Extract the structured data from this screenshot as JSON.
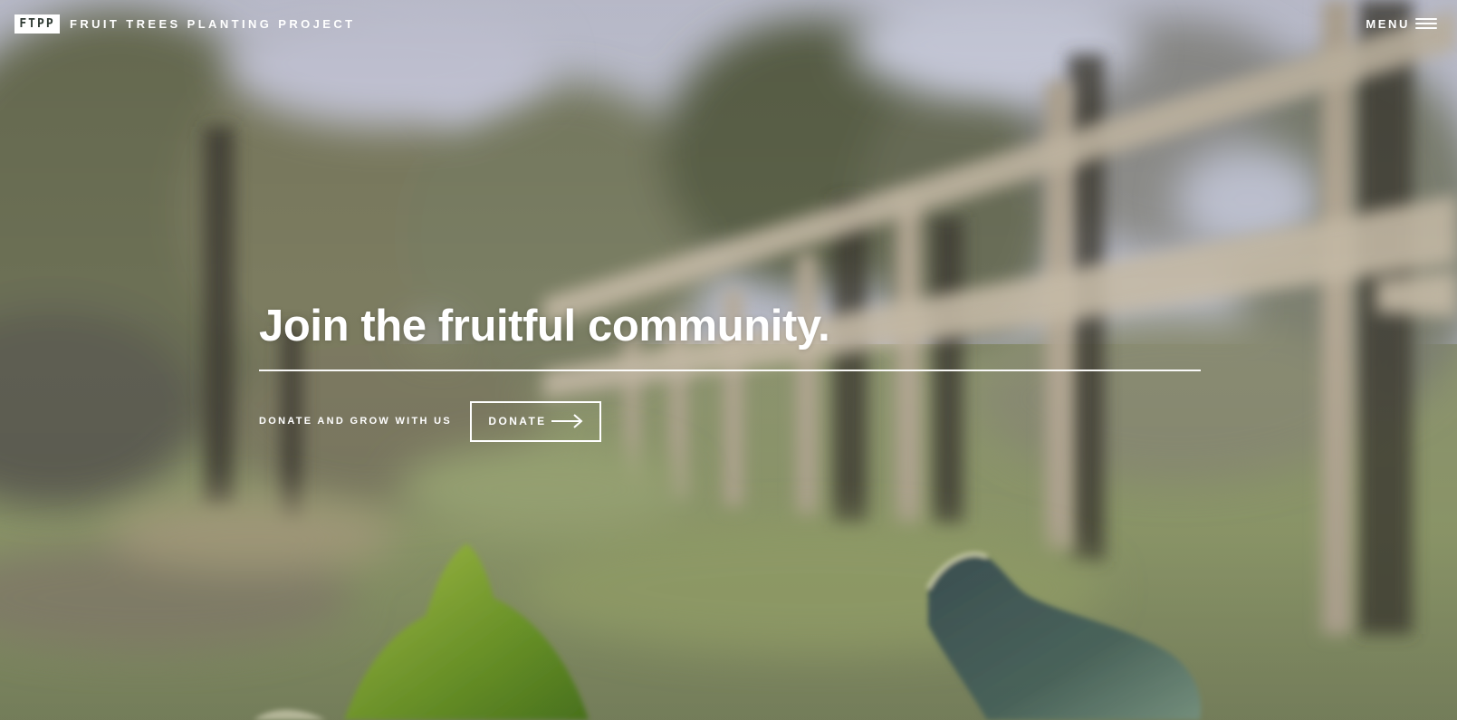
{
  "header": {
    "logo_text": "FTPP",
    "site_name": "FRUIT TREES PLANTING PROJECT",
    "menu_label": "MENU"
  },
  "hero": {
    "title": "Join the fruitful community.",
    "cta_text": "DONATE AND GROW WITH US",
    "donate_label": "DONATE"
  },
  "icons": {
    "menu": "hamburger-icon",
    "donate": "arrow-right-icon"
  },
  "colors": {
    "text": "#ffffff",
    "logo_bg": "#ffffff",
    "logo_text": "#2f3a33",
    "sky": "#c3c6d6",
    "foliage": "#6f7a55",
    "grass": "#8e9a6a",
    "fence": "#b6ab98"
  }
}
